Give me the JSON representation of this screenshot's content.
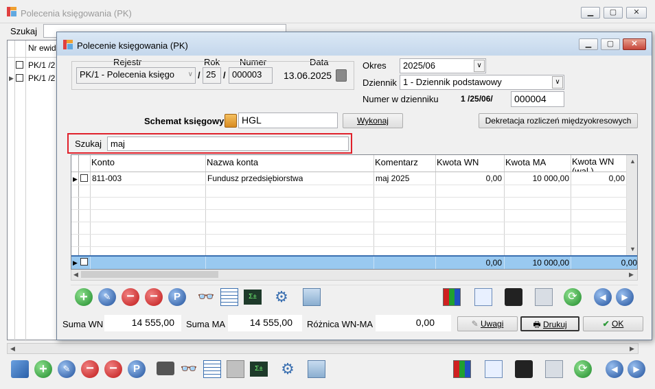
{
  "background_window": {
    "title": "Polecenia księgowania (PK)",
    "search_label": "Szukaj",
    "col_header": "Nr ewid",
    "rows": [
      "PK/1 /2",
      "PK/1 /2"
    ]
  },
  "dialog": {
    "title": "Polecenie księgowania (PK)",
    "rejestr_label": "Rejestr",
    "rejestr_value": "PK/1   - Polecenia księgo",
    "rok_label": "Rok",
    "rok_value": "25",
    "numer_label": "Numer",
    "numer_value": "000003",
    "data_label": "Data",
    "data_value": "13.06.2025",
    "slash": "/",
    "okres_label": "Okres",
    "okres_value": "2025/06",
    "dziennik_label": "Dziennik",
    "dziennik_value": "1  - Dziennik podstawowy",
    "numer_w_dzienniku_label": "Numer w dzienniku",
    "numer_w_dzienniku_prefix": "1 /25/06/",
    "numer_w_dzienniku_value": "000004",
    "schemat_label": "Schemat księgowy",
    "schemat_value": "HGL",
    "wykonaj_label": "Wykonaj",
    "dekretacja_label": "Dekretacja rozliczeń międzyokresowych",
    "search_label": "Szukaj",
    "search_value": "maj",
    "columns": [
      "Konto",
      "Nazwa konta",
      "Komentarz",
      "Kwota WN",
      "Kwota MA",
      "Kwota WN (wal.)"
    ],
    "rows": [
      {
        "konto": "811-003",
        "nazwa": "Fundusz przedsiębiorstwa",
        "komentarz": "maj 2025",
        "kwota_wn": "0,00",
        "kwota_ma": "10 000,00",
        "kwota_wn_wal": "0,00"
      }
    ],
    "totals": {
      "kwota_wn": "0,00",
      "kwota_ma": "10 000,00",
      "kwota_wn_wal": "0,00"
    },
    "suma_wn_label": "Suma WN",
    "suma_wn_value": "14 555,00",
    "suma_ma_label": "Suma MA",
    "suma_ma_value": "14 555,00",
    "roznica_label": "Różnica WN-MA",
    "roznica_value": "0,00",
    "uwagi_label": "Uwagi",
    "drukuj_label": "Drukuj",
    "ok_label": "OK"
  },
  "colors": {
    "accent_blue": "#99c9f0",
    "highlight_red": "#e0202a",
    "green": "#2e9a3a"
  }
}
